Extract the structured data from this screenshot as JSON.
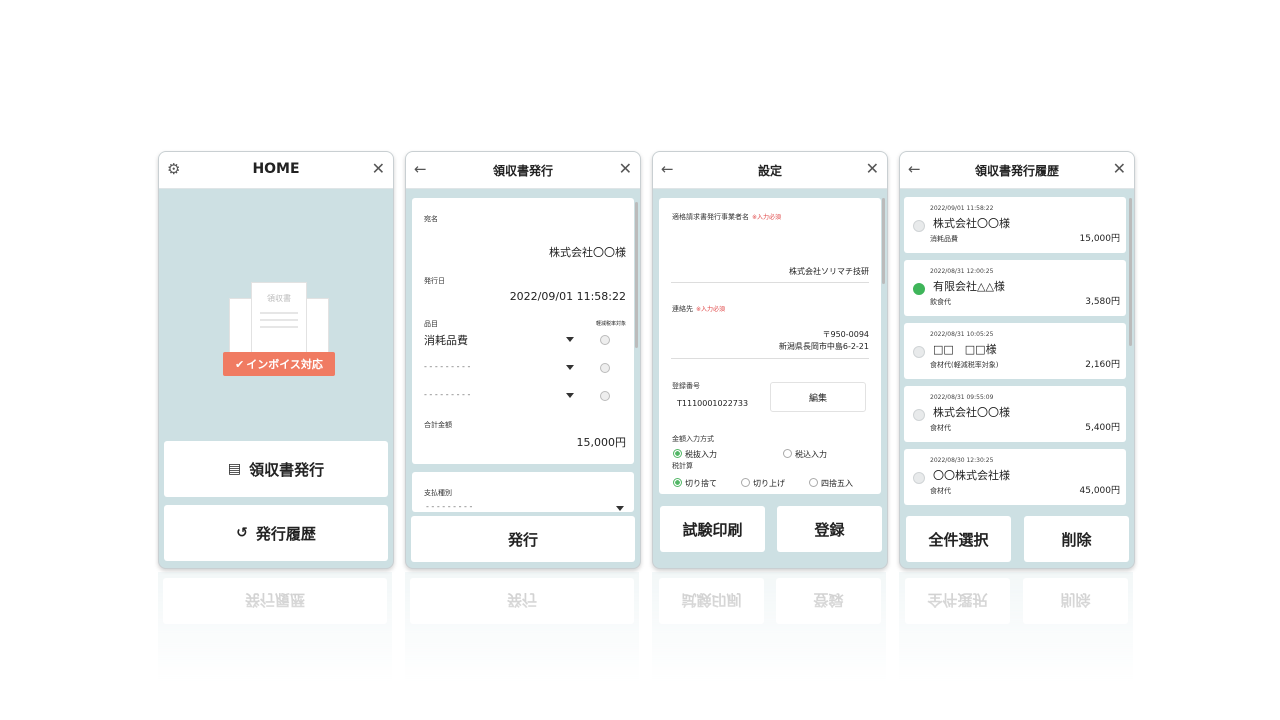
{
  "home": {
    "title": "HOME",
    "badge": "インボイス対応",
    "doc_label": "領収書",
    "issue_button": "領収書発行",
    "history_button": "発行履歴"
  },
  "issue": {
    "title": "領収書発行",
    "addressee_label": "宛名",
    "addressee_value": "株式会社〇〇様",
    "date_label": "発行日",
    "date_value": "2022/09/01 11:58:22",
    "item_label": "品目",
    "reduced_label": "軽減税率対象",
    "items": [
      "消耗品費",
      "- - - - - - - - -",
      "- - - - - - - - -"
    ],
    "total_label": "合計金額",
    "total_value": "15,000円",
    "payment_label": "支払種別",
    "payment_value": "- - - - - - - - -",
    "submit_button": "発行"
  },
  "settings": {
    "title": "設定",
    "issuer_label": "適格請求書発行事業者名",
    "required": "※入力必須",
    "issuer_value": "株式会社ソリマチ技研",
    "contact_label": "連絡先",
    "contact_postal": "〒950-0094",
    "contact_address": "新潟県長岡市中島6-2-21",
    "reg_label": "登録番号",
    "reg_value": "T1110001022733",
    "edit_button": "編集",
    "amount_mode_label": "金額入力方式",
    "amount_modes": [
      "税抜入力",
      "税込入力"
    ],
    "rounding_label": "税計算",
    "rounding_modes": [
      "切り捨て",
      "切り上げ",
      "四捨五入"
    ],
    "test_print_button": "試験印刷",
    "register_button": "登録"
  },
  "history": {
    "title": "領収書発行履歴",
    "rows": [
      {
        "date": "2022/09/01 11:58:22",
        "name": "株式会社〇〇様",
        "item": "消耗品費",
        "amount": "15,000円",
        "checked": false
      },
      {
        "date": "2022/08/31 12:00:25",
        "name": "有限会社△△様",
        "item": "飲食代",
        "amount": "3,580円",
        "checked": true
      },
      {
        "date": "2022/08/31 10:05:25",
        "name": "□□　□□様",
        "item": "食材代(軽減税率対象)",
        "amount": "2,160円",
        "checked": false
      },
      {
        "date": "2022/08/31 09:55:09",
        "name": "株式会社〇〇様",
        "item": "食材代",
        "amount": "5,400円",
        "checked": false
      },
      {
        "date": "2022/08/30 12:30:25",
        "name": "〇〇株式会社様",
        "item": "食材代",
        "amount": "45,000円",
        "checked": false
      }
    ],
    "select_all_button": "全件選択",
    "delete_button": "削除"
  },
  "colors": {
    "panel_bg": "#cde0e3",
    "badge": "#f07b62",
    "check": "#3fb55a",
    "required": "#e04848"
  }
}
